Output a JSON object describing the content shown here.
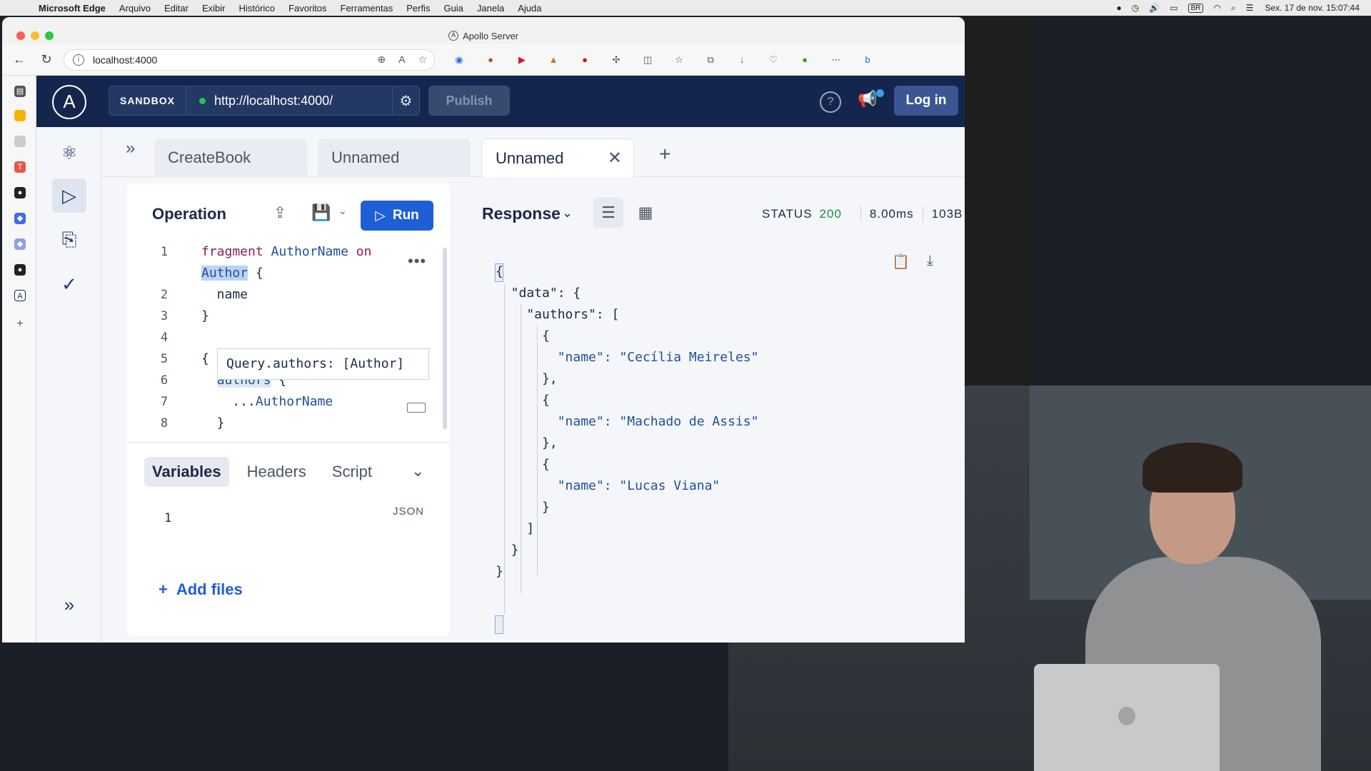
{
  "menubar": {
    "app": "Microsoft Edge",
    "items": [
      "Arquivo",
      "Editar",
      "Exibir",
      "Histórico",
      "Favoritos",
      "Ferramentas",
      "Perfis",
      "Guia",
      "Janela",
      "Ajuda"
    ],
    "input_source": "BR",
    "clock": "Sex. 17 de nov.  15:07:44"
  },
  "browser": {
    "window_title": "Apollo Server",
    "url": "localhost:4000"
  },
  "apollo": {
    "sandbox_label": "SANDBOX",
    "endpoint": "http://localhost:4000/",
    "publish_label": "Publish",
    "login_label": "Log in",
    "tabs": [
      {
        "label": "CreateBook"
      },
      {
        "label": "Unnamed"
      },
      {
        "label": "Unnamed"
      }
    ],
    "operation": {
      "title": "Operation",
      "run_label": "Run",
      "tooltip": "Query.authors: [Author]",
      "lines": [
        {
          "n": "1",
          "text": "fragment AuthorName on"
        },
        {
          "n": "",
          "text": "Author {"
        },
        {
          "n": "2",
          "text": "  name"
        },
        {
          "n": "3",
          "text": "}"
        },
        {
          "n": "4",
          "text": ""
        },
        {
          "n": "5",
          "text": "{"
        },
        {
          "n": "6",
          "text": "  authors {"
        },
        {
          "n": "7",
          "text": "    ...AuthorName"
        },
        {
          "n": "8",
          "text": "  }"
        }
      ]
    },
    "variables": {
      "tabs": [
        "Variables",
        "Headers",
        "Script"
      ],
      "line_number": "1",
      "format": "JSON",
      "add_files_label": "Add files"
    },
    "response": {
      "title": "Response",
      "status_label": "STATUS",
      "status_code": "200",
      "time": "8.00ms",
      "size": "103B",
      "body_lines": [
        "{",
        "  \"data\": {",
        "    \"authors\": [",
        "      {",
        "        \"name\": \"Cecília Meireles\"",
        "      },",
        "      {",
        "        \"name\": \"Machado de Assis\"",
        "      },",
        "      {",
        "        \"name\": \"Lucas Viana\"",
        "      }",
        "    ]",
        "  }",
        "}"
      ]
    }
  },
  "colors": {
    "header_bg": "#15264e",
    "run_button": "#1f5fd6",
    "status_ok": "#1a8a3e"
  }
}
